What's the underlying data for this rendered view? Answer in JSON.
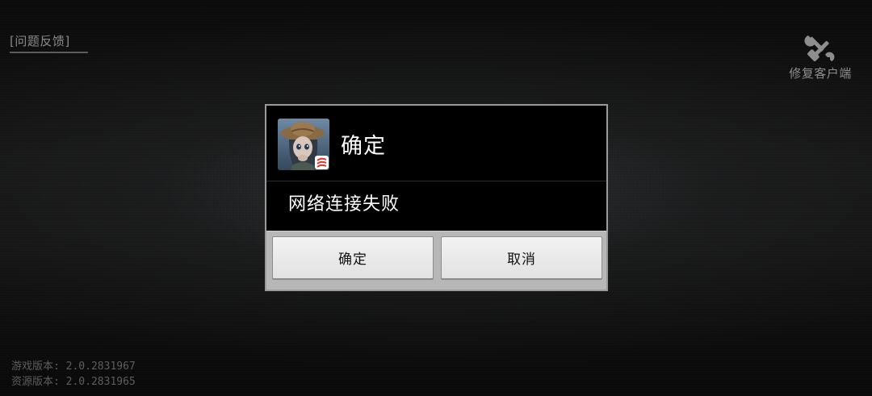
{
  "top_left": {
    "feedback_label": "[问题反馈]"
  },
  "top_right": {
    "repair_label": "修复客户端",
    "repair_icon": "wrench-screwdriver-icon"
  },
  "version_info": {
    "game_version": "游戏版本: 2.0.2831967",
    "resource_version": "资源版本: 2.0.2831965"
  },
  "dialog": {
    "app_icon": "game-character-icon",
    "title": "确定",
    "message": "网络连接失败",
    "confirm_label": "确定",
    "cancel_label": "取消"
  },
  "colors": {
    "dialog_bg": "#000000",
    "button_bar_bg": "#b7b7b7",
    "button_bg": "#eaeaea",
    "muted_text": "#8a8a8a",
    "brand_red": "#e4312b"
  }
}
